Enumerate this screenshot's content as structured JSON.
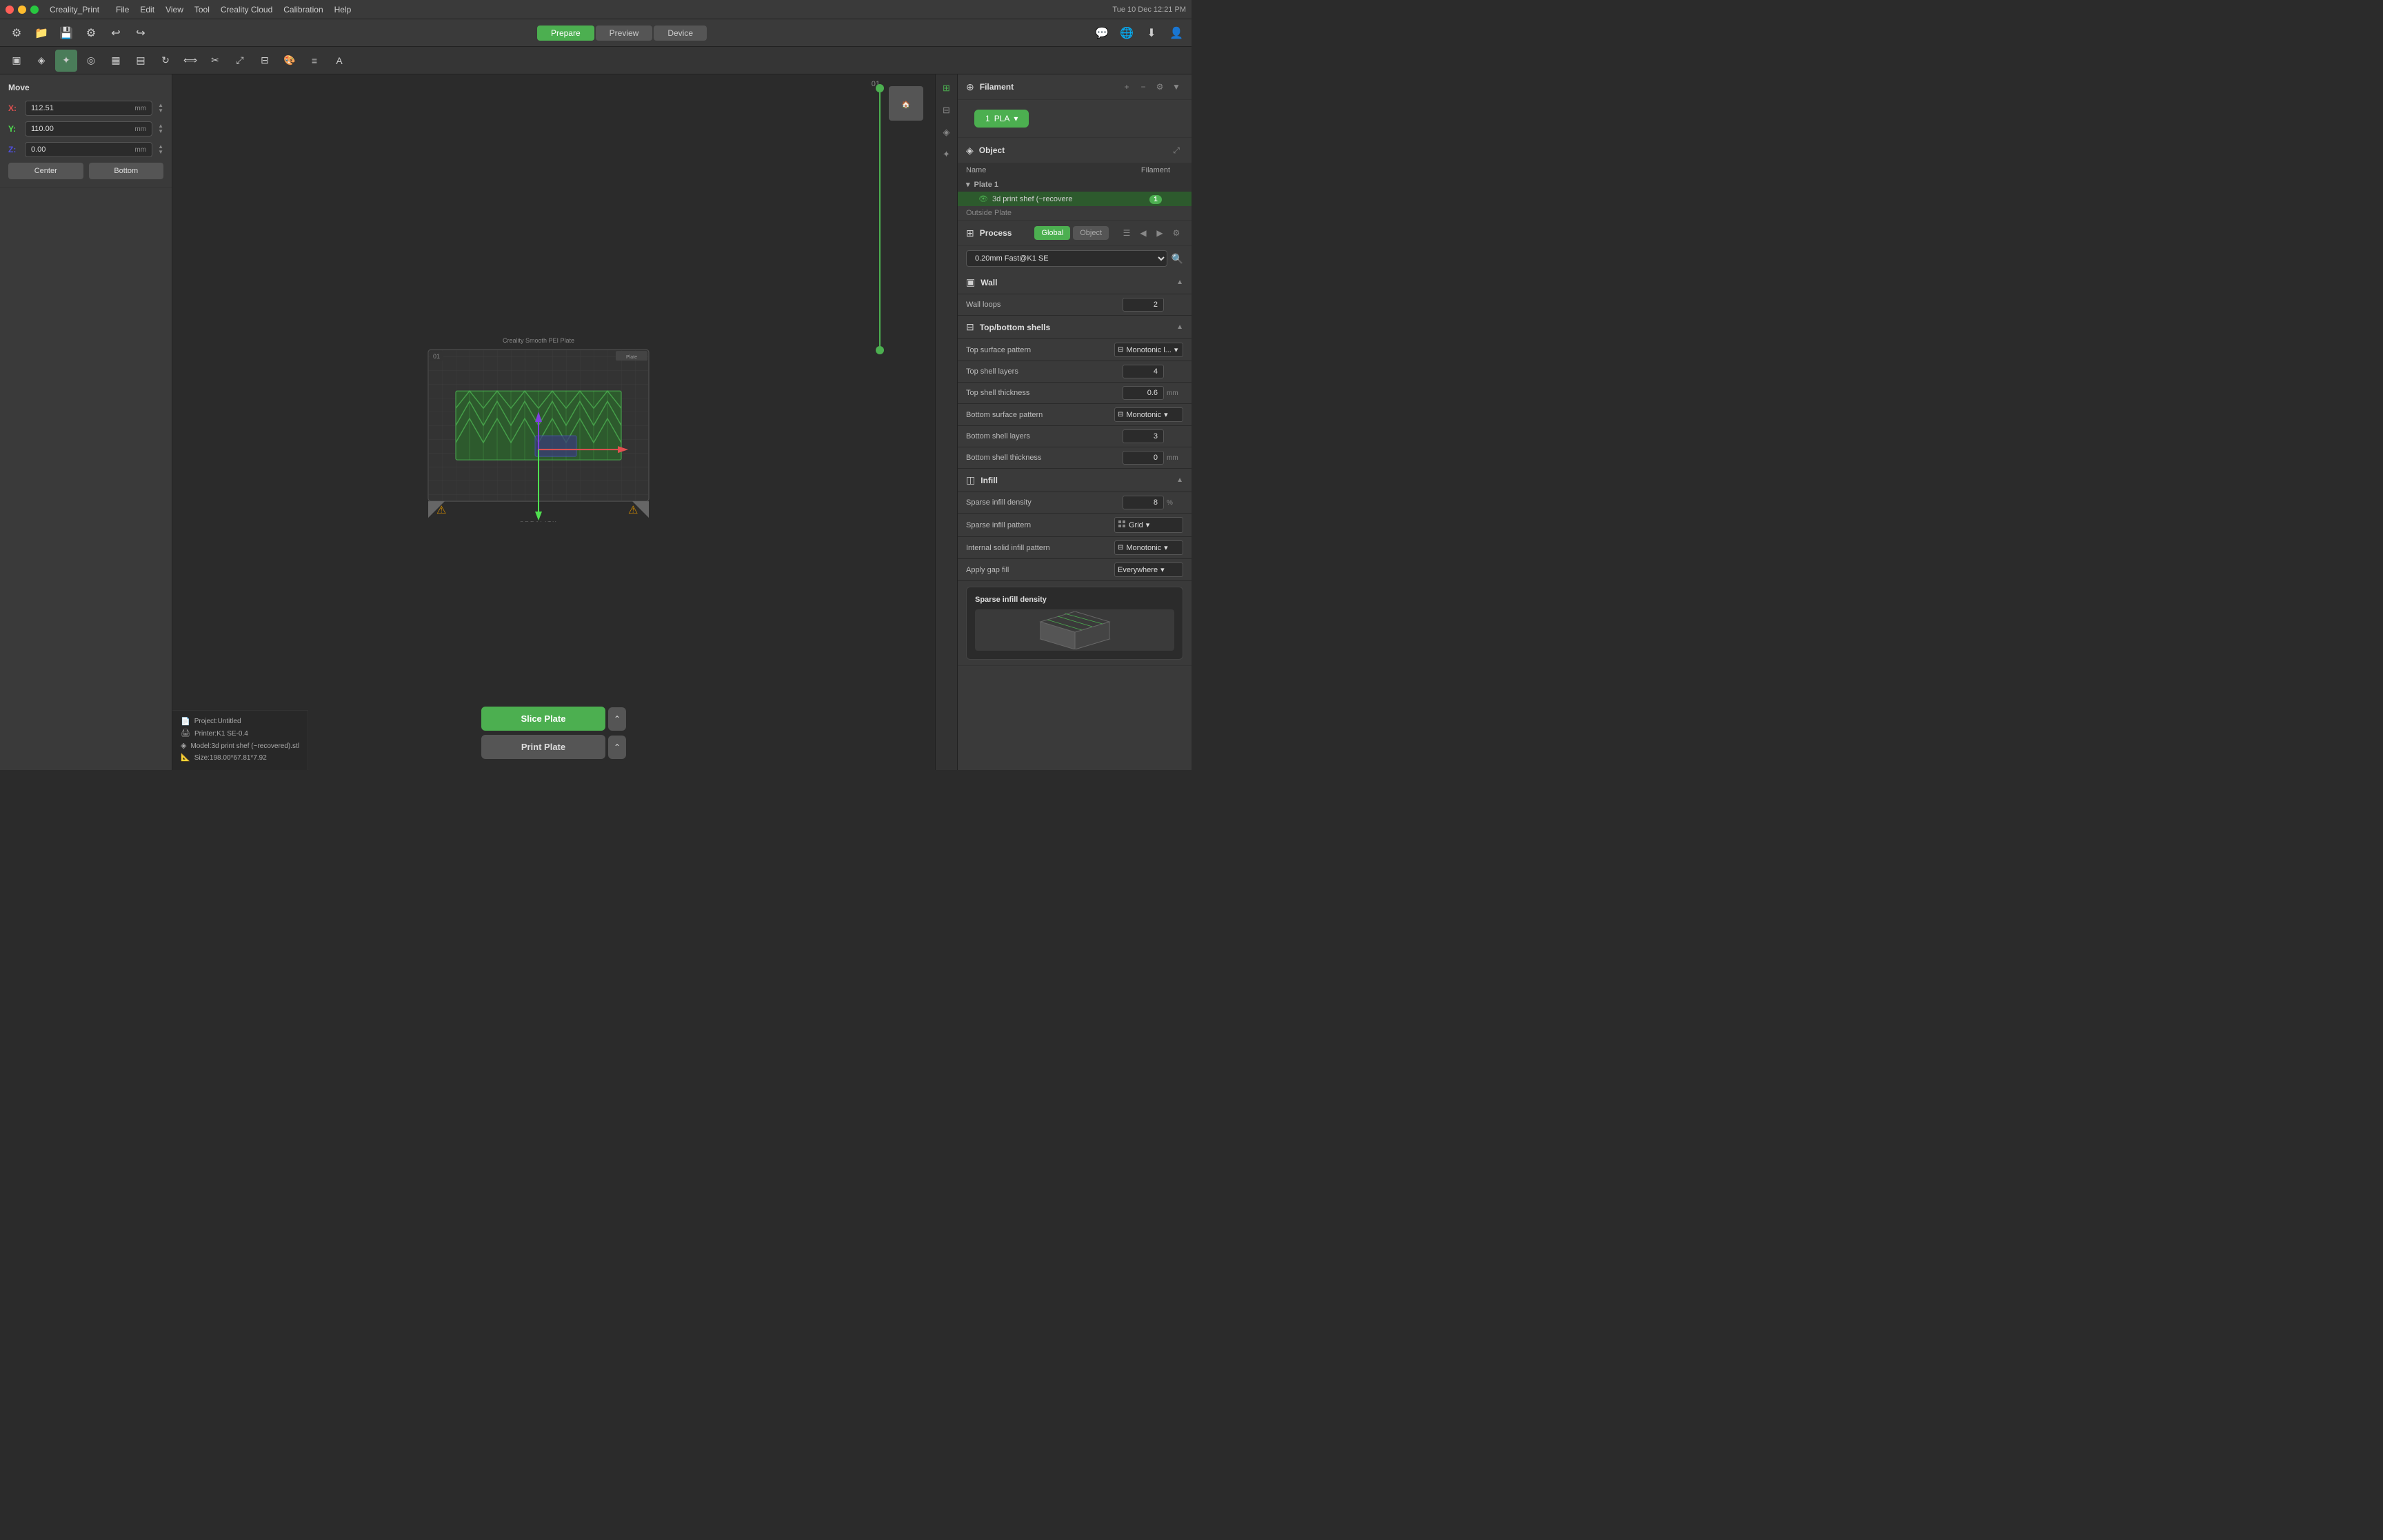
{
  "app": {
    "name": "Creality_Print",
    "title": "Creality_Print"
  },
  "macos": {
    "time": "Tue 10 Dec  12:21 PM",
    "menus": [
      "File",
      "Edit",
      "View",
      "Tool",
      "Creality Cloud",
      "Calibration",
      "Help"
    ]
  },
  "toolbar": {
    "modes": {
      "prepare": "Prepare",
      "preview": "Preview",
      "device": "Device"
    },
    "active_mode": "Prepare"
  },
  "move_panel": {
    "title": "Move",
    "x": "112.51",
    "y": "110.00",
    "z": "0.00",
    "unit": "mm",
    "center_btn": "Center",
    "bottom_btn": "Bottom"
  },
  "viewport": {
    "label": "01",
    "bed_label": "Creality Smooth PEI Plate"
  },
  "filament": {
    "section_title": "Filament",
    "count": "1",
    "type": "PLA"
  },
  "object": {
    "section_title": "Object",
    "columns": {
      "name": "Name",
      "filament": "Filament"
    },
    "plate": "Plate 1",
    "model_name": "3d print shef (~recovere",
    "model_filament": "1",
    "outside_plate": "Outside Plate"
  },
  "process": {
    "section_title": "Process",
    "tabs": [
      "Global",
      "Object"
    ],
    "active_tab": "Global",
    "preset": "0.20mm Fast@K1 SE",
    "sections": {
      "wall": {
        "title": "Wall",
        "wall_loops_label": "Wall loops",
        "wall_loops_value": "2"
      },
      "top_bottom": {
        "title": "Top/bottom shells",
        "top_surface_pattern_label": "Top surface pattern",
        "top_surface_pattern_value": "Monotonic l...",
        "top_shell_layers_label": "Top shell layers",
        "top_shell_layers_value": "4",
        "top_shell_thickness_label": "Top shell thickness",
        "top_shell_thickness_value": "0.6",
        "top_shell_thickness_unit": "mm",
        "bottom_surface_pattern_label": "Bottom surface pattern",
        "bottom_surface_pattern_value": "Monotonic",
        "bottom_shell_layers_label": "Bottom shell layers",
        "bottom_shell_layers_value": "3",
        "bottom_shell_thickness_label": "Bottom shell thickness",
        "bottom_shell_thickness_value": "0",
        "bottom_shell_thickness_unit": "mm"
      },
      "infill": {
        "title": "Infill",
        "sparse_density_label": "Sparse infill density",
        "sparse_density_value": "8",
        "sparse_density_unit": "%",
        "sparse_pattern_label": "Sparse infill pattern",
        "sparse_pattern_value": "Grid",
        "internal_solid_label": "Internal solid infill pattern",
        "internal_solid_value": "Monotonic",
        "apply_gap_label": "Apply gap fill",
        "apply_gap_value": "Everywhere"
      }
    }
  },
  "tooltip": {
    "title": "Sparse infill density"
  },
  "bottom_buttons": {
    "slice": "Slice Plate",
    "print": "Print Plate"
  },
  "info_panel": {
    "project": "Project:Untitled",
    "printer": "Printer:K1 SE-0.4",
    "model": "Model:3d print shef (~recovered).stl",
    "size": "Size:198.00*67.81*7.92"
  },
  "colors": {
    "green": "#4CAF50",
    "dark_bg": "#2b2b2b",
    "panel_bg": "#3a3a3a",
    "border": "#333333",
    "text_primary": "#dddddd",
    "text_secondary": "#aaaaaa",
    "accent_green": "#4a7c59"
  }
}
